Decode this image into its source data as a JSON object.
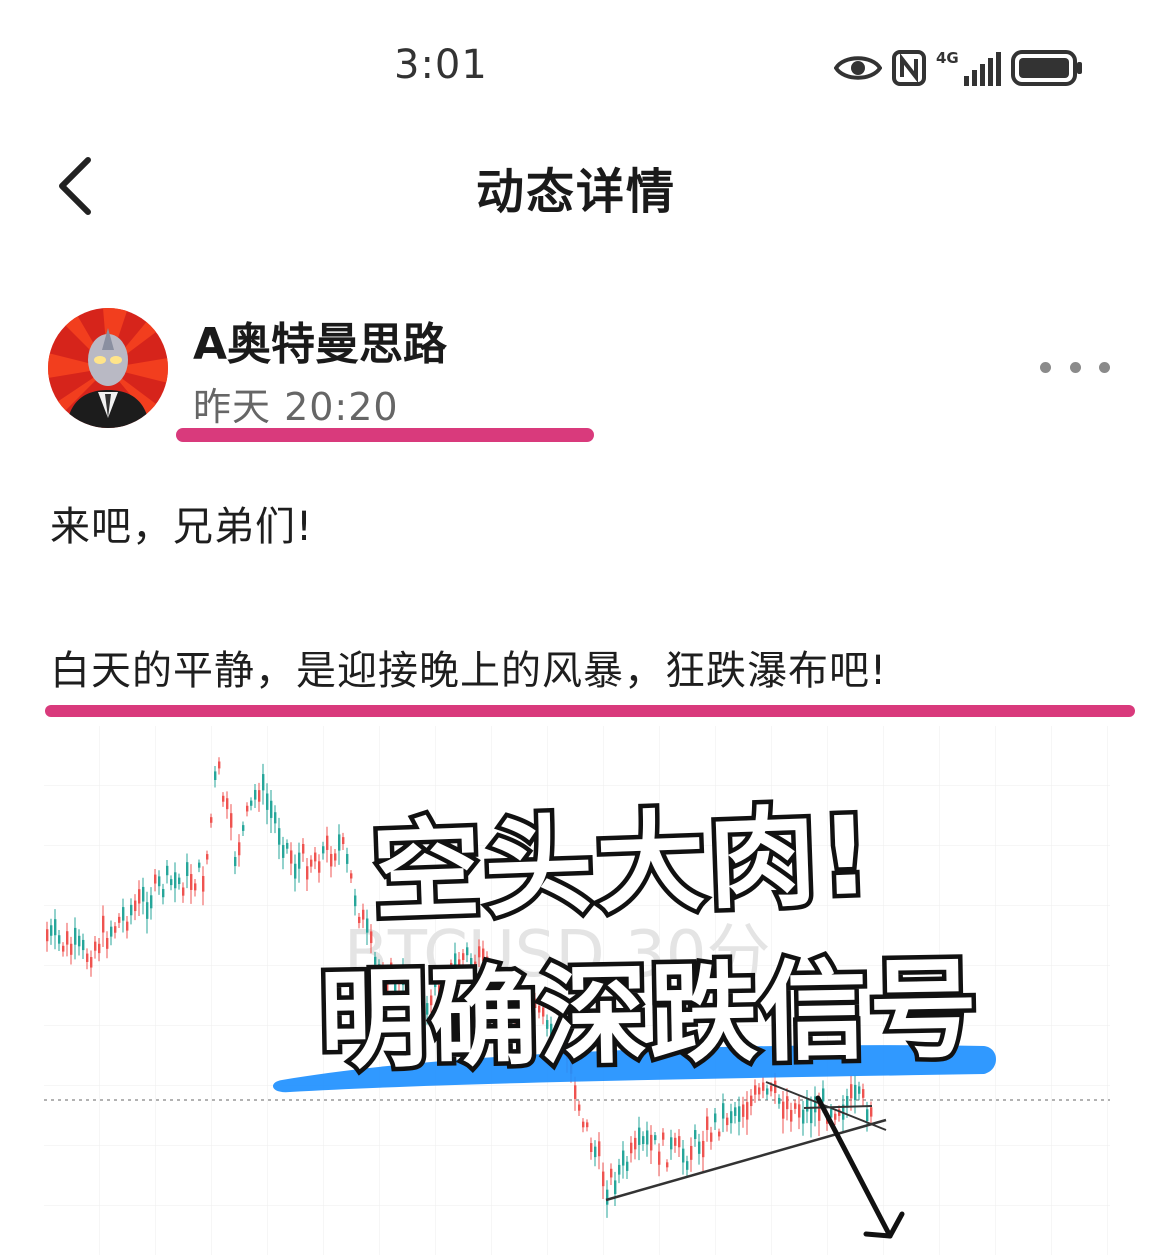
{
  "status_bar": {
    "time": "3:01",
    "network": "4G",
    "icons": [
      "eye-icon",
      "nfc-icon",
      "signal-icon",
      "battery-icon"
    ]
  },
  "header": {
    "title": "动态详情",
    "back_icon": "chevron-left-icon"
  },
  "post": {
    "author": "A奥特曼思路",
    "time": "昨天 20:20",
    "more_icon": "more-dots-icon",
    "lines": [
      "来吧，兄弟们!",
      "白天的平静，是迎接晚上的风暴，狂跌瀑布吧!"
    ],
    "image": {
      "headline": "空头大肉!",
      "subheadline": "明确深跌信号",
      "watermark": "BTCUSD 30分"
    }
  },
  "colors": {
    "highlight": "#d93a7c",
    "brush": "#1e90ff",
    "candle_up": "#26a69a",
    "candle_down": "#ef5350"
  }
}
